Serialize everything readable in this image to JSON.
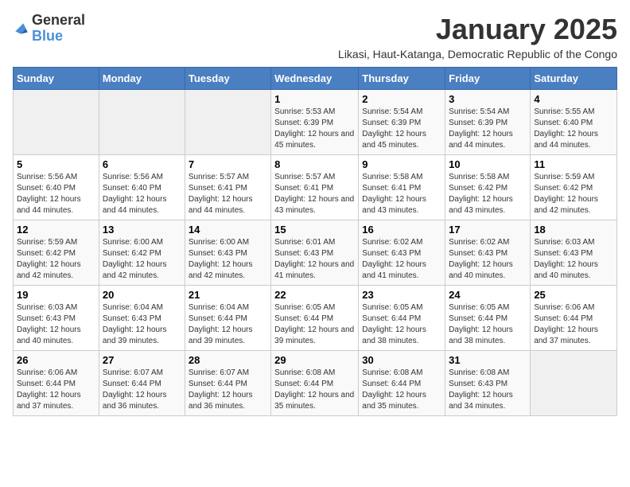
{
  "logo": {
    "general": "General",
    "blue": "Blue"
  },
  "title": "January 2025",
  "subtitle": "Likasi, Haut-Katanga, Democratic Republic of the Congo",
  "weekdays": [
    "Sunday",
    "Monday",
    "Tuesday",
    "Wednesday",
    "Thursday",
    "Friday",
    "Saturday"
  ],
  "weeks": [
    [
      {
        "day": "",
        "info": ""
      },
      {
        "day": "",
        "info": ""
      },
      {
        "day": "",
        "info": ""
      },
      {
        "day": "1",
        "info": "Sunrise: 5:53 AM\nSunset: 6:39 PM\nDaylight: 12 hours and 45 minutes."
      },
      {
        "day": "2",
        "info": "Sunrise: 5:54 AM\nSunset: 6:39 PM\nDaylight: 12 hours and 45 minutes."
      },
      {
        "day": "3",
        "info": "Sunrise: 5:54 AM\nSunset: 6:39 PM\nDaylight: 12 hours and 44 minutes."
      },
      {
        "day": "4",
        "info": "Sunrise: 5:55 AM\nSunset: 6:40 PM\nDaylight: 12 hours and 44 minutes."
      }
    ],
    [
      {
        "day": "5",
        "info": "Sunrise: 5:56 AM\nSunset: 6:40 PM\nDaylight: 12 hours and 44 minutes."
      },
      {
        "day": "6",
        "info": "Sunrise: 5:56 AM\nSunset: 6:40 PM\nDaylight: 12 hours and 44 minutes."
      },
      {
        "day": "7",
        "info": "Sunrise: 5:57 AM\nSunset: 6:41 PM\nDaylight: 12 hours and 44 minutes."
      },
      {
        "day": "8",
        "info": "Sunrise: 5:57 AM\nSunset: 6:41 PM\nDaylight: 12 hours and 43 minutes."
      },
      {
        "day": "9",
        "info": "Sunrise: 5:58 AM\nSunset: 6:41 PM\nDaylight: 12 hours and 43 minutes."
      },
      {
        "day": "10",
        "info": "Sunrise: 5:58 AM\nSunset: 6:42 PM\nDaylight: 12 hours and 43 minutes."
      },
      {
        "day": "11",
        "info": "Sunrise: 5:59 AM\nSunset: 6:42 PM\nDaylight: 12 hours and 42 minutes."
      }
    ],
    [
      {
        "day": "12",
        "info": "Sunrise: 5:59 AM\nSunset: 6:42 PM\nDaylight: 12 hours and 42 minutes."
      },
      {
        "day": "13",
        "info": "Sunrise: 6:00 AM\nSunset: 6:42 PM\nDaylight: 12 hours and 42 minutes."
      },
      {
        "day": "14",
        "info": "Sunrise: 6:00 AM\nSunset: 6:43 PM\nDaylight: 12 hours and 42 minutes."
      },
      {
        "day": "15",
        "info": "Sunrise: 6:01 AM\nSunset: 6:43 PM\nDaylight: 12 hours and 41 minutes."
      },
      {
        "day": "16",
        "info": "Sunrise: 6:02 AM\nSunset: 6:43 PM\nDaylight: 12 hours and 41 minutes."
      },
      {
        "day": "17",
        "info": "Sunrise: 6:02 AM\nSunset: 6:43 PM\nDaylight: 12 hours and 40 minutes."
      },
      {
        "day": "18",
        "info": "Sunrise: 6:03 AM\nSunset: 6:43 PM\nDaylight: 12 hours and 40 minutes."
      }
    ],
    [
      {
        "day": "19",
        "info": "Sunrise: 6:03 AM\nSunset: 6:43 PM\nDaylight: 12 hours and 40 minutes."
      },
      {
        "day": "20",
        "info": "Sunrise: 6:04 AM\nSunset: 6:43 PM\nDaylight: 12 hours and 39 minutes."
      },
      {
        "day": "21",
        "info": "Sunrise: 6:04 AM\nSunset: 6:44 PM\nDaylight: 12 hours and 39 minutes."
      },
      {
        "day": "22",
        "info": "Sunrise: 6:05 AM\nSunset: 6:44 PM\nDaylight: 12 hours and 39 minutes."
      },
      {
        "day": "23",
        "info": "Sunrise: 6:05 AM\nSunset: 6:44 PM\nDaylight: 12 hours and 38 minutes."
      },
      {
        "day": "24",
        "info": "Sunrise: 6:05 AM\nSunset: 6:44 PM\nDaylight: 12 hours and 38 minutes."
      },
      {
        "day": "25",
        "info": "Sunrise: 6:06 AM\nSunset: 6:44 PM\nDaylight: 12 hours and 37 minutes."
      }
    ],
    [
      {
        "day": "26",
        "info": "Sunrise: 6:06 AM\nSunset: 6:44 PM\nDaylight: 12 hours and 37 minutes."
      },
      {
        "day": "27",
        "info": "Sunrise: 6:07 AM\nSunset: 6:44 PM\nDaylight: 12 hours and 36 minutes."
      },
      {
        "day": "28",
        "info": "Sunrise: 6:07 AM\nSunset: 6:44 PM\nDaylight: 12 hours and 36 minutes."
      },
      {
        "day": "29",
        "info": "Sunrise: 6:08 AM\nSunset: 6:44 PM\nDaylight: 12 hours and 35 minutes."
      },
      {
        "day": "30",
        "info": "Sunrise: 6:08 AM\nSunset: 6:44 PM\nDaylight: 12 hours and 35 minutes."
      },
      {
        "day": "31",
        "info": "Sunrise: 6:08 AM\nSunset: 6:43 PM\nDaylight: 12 hours and 34 minutes."
      },
      {
        "day": "",
        "info": ""
      }
    ]
  ]
}
